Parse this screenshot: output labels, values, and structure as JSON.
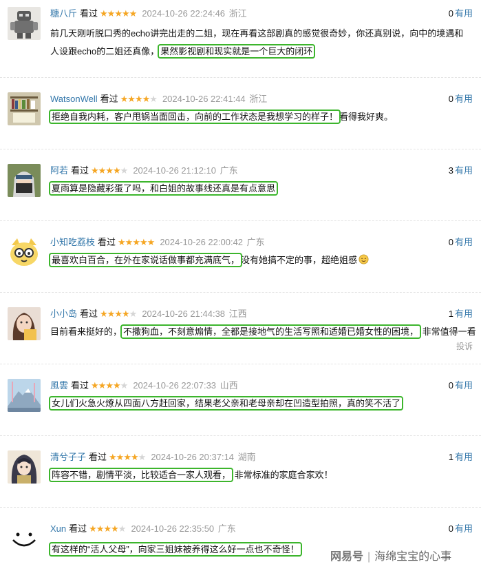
{
  "reviews": [
    {
      "name": "糖八斤",
      "watched": "看过",
      "stars": 5,
      "stars_text": "★★★★★",
      "time": "2024-10-26 22:24:46",
      "location": "浙江",
      "votes": "0",
      "vote_label": "有用",
      "text_line1": "前几天刚听脱口秀的echo讲完出走的二姐，现在再看这部剧真的感觉很奇妙，你还真别说，向中的境遇和",
      "text_line2": "人设跟echo的二姐还真像，",
      "highlight": "果然影视剧和现实就是一个巨大的闭环",
      "avatar": "robot-toy-avatar"
    },
    {
      "name": "WatsonWell",
      "watched": "看过",
      "stars": 4,
      "stars_text": "★★★★★",
      "time": "2024-10-26 22:41:44",
      "location": "浙江",
      "votes": "0",
      "vote_label": "有用",
      "highlight": "拒绝自我内耗，客户甩锅当面回击，向前的工作状态是我想学习的样子！",
      "after": "看得我好爽。",
      "avatar": "bookshelf-avatar"
    },
    {
      "name": "阿若",
      "watched": "看过",
      "stars": 4,
      "stars_text": "★★★★★",
      "time": "2024-10-26 21:12:10",
      "location": "广东",
      "votes": "3",
      "vote_label": "有用",
      "highlight": "夏雨算是隐藏彩蛋了吗，和白姐的故事线还真是有点意思",
      "avatar": "masked-ninja-avatar"
    },
    {
      "name": "小知吃荔枝",
      "watched": "看过",
      "stars": 5,
      "stars_text": "★★★★★",
      "time": "2024-10-26 22:00:42",
      "location": "广东",
      "votes": "0",
      "vote_label": "有用",
      "highlight": "最喜欢白百合，在外在家说话做事都充满底气，",
      "after": "没有她搞不定的事，超绝姐感",
      "avatar": "cartoon-dog-avatar"
    },
    {
      "name": "小小岛",
      "watched": "看过",
      "stars": 4,
      "stars_text": "★★★★★",
      "time": "2024-10-26 21:44:38",
      "location": "江西",
      "votes": "1",
      "vote_label": "有用",
      "before": "目前看来挺好的，",
      "highlight": "不撒狗血，不刻意煽情，全都是接地气的生活写照和适婚已婚女性的困境，",
      "after": "非常值得一看",
      "report": "投诉",
      "avatar": "woman-selfie-avatar"
    },
    {
      "name": "風雲",
      "watched": "看过",
      "stars": 4,
      "stars_text": "★★★★★",
      "time": "2024-10-26 22:07:33",
      "location": "山西",
      "votes": "0",
      "vote_label": "有用",
      "highlight": "女儿们火急火燎从四面八方赶回家，结果老父亲和老母亲却在凹造型拍照，真的笑不活了",
      "avatar": "mountain-avatar"
    },
    {
      "name": "清兮子子",
      "watched": "看过",
      "stars": 4,
      "stars_text": "★★★★★",
      "time": "2024-10-26 20:37:14",
      "location": "湖南",
      "votes": "1",
      "vote_label": "有用",
      "highlight": "阵容不错，剧情平淡，比较适合一家人观看，",
      "after": "非常标准的家庭合家欢！",
      "avatar": "anime-character-avatar"
    },
    {
      "name": "Xun",
      "watched": "看过",
      "stars": 4,
      "stars_text": "★★★★★",
      "time": "2024-10-26 22:35:50",
      "location": "广东",
      "votes": "0",
      "vote_label": "有用",
      "highlight": "有这样的“活人父母”，向家三姐妹被养得这么好一点也不奇怪！",
      "avatar": "smiley-face-avatar"
    }
  ],
  "watermark": {
    "brand": "网易号",
    "separator": "|",
    "author": "海绵宝宝的心事"
  },
  "colors": {
    "link": "#3377aa",
    "star": "#f5a623",
    "highlight_border": "#3cb52c",
    "meta": "#999999"
  }
}
